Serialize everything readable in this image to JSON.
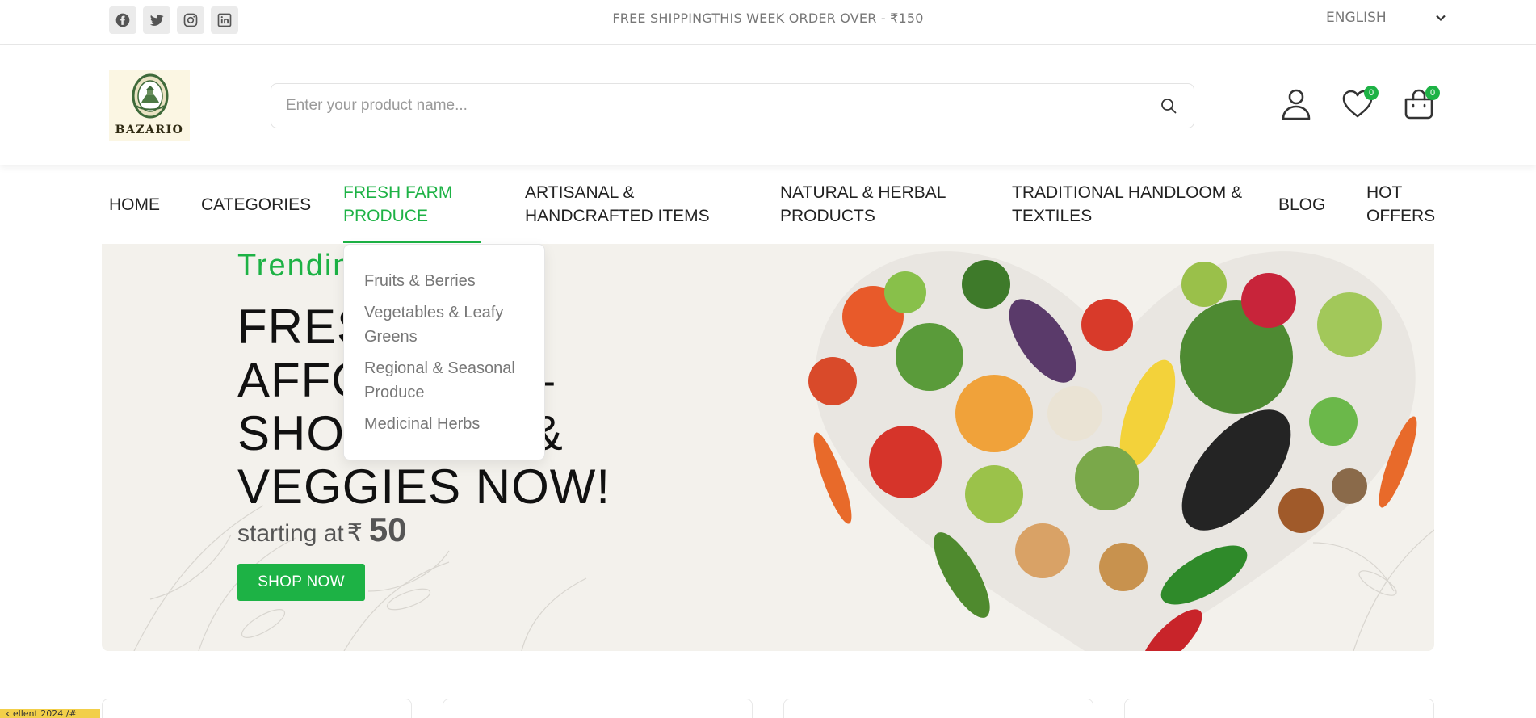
{
  "topbar": {
    "social": [
      {
        "icon": "facebook-icon"
      },
      {
        "icon": "twitter-icon"
      },
      {
        "icon": "instagram-icon"
      },
      {
        "icon": "linkedin-icon"
      }
    ],
    "promo": "FREE SHIPPINGTHIS WEEK ORDER OVER - ₹150",
    "language": "ENGLISH"
  },
  "header": {
    "brand": "BAZARIO",
    "search_placeholder": "Enter your product name...",
    "wishlist_count": "0",
    "cart_count": "0"
  },
  "nav": {
    "items": [
      {
        "line1": "HOME",
        "line2": ""
      },
      {
        "line1": "CATEGORIES",
        "line2": ""
      },
      {
        "line1": "FRESH FARM",
        "line2": "PRODUCE"
      },
      {
        "line1": "ARTISANAL &",
        "line2": "HANDCRAFTED ITEMS"
      },
      {
        "line1": "NATURAL & HERBAL",
        "line2": "PRODUCTS"
      },
      {
        "line1": "TRADITIONAL HANDLOOM &",
        "line2": "TEXTILES"
      },
      {
        "line1": "BLOG",
        "line2": ""
      },
      {
        "line1": "HOT",
        "line2": "OFFERS"
      }
    ],
    "active_index": 2
  },
  "dropdown": {
    "items": [
      {
        "line1": "Fruits & Berries",
        "line2": ""
      },
      {
        "line1": "Vegetables & Leafy",
        "line2": "Greens"
      },
      {
        "line1": "Regional & Seasonal",
        "line2": "Produce"
      },
      {
        "line1": "Medicinal Herbs",
        "line2": ""
      }
    ]
  },
  "hero": {
    "kicker": "Trendin",
    "headline_lines": [
      "FRES",
      "AFFO           –",
      "SHO             &",
      "VEGGIES NOW!"
    ],
    "price_prefix": "starting at",
    "currency": "₹",
    "price": "50",
    "cta": "SHOP NOW"
  },
  "cookie_bar": "k  ellent 2024 /#",
  "colors": {
    "accent": "#1db245",
    "text": "#212121",
    "muted": "#777777"
  }
}
